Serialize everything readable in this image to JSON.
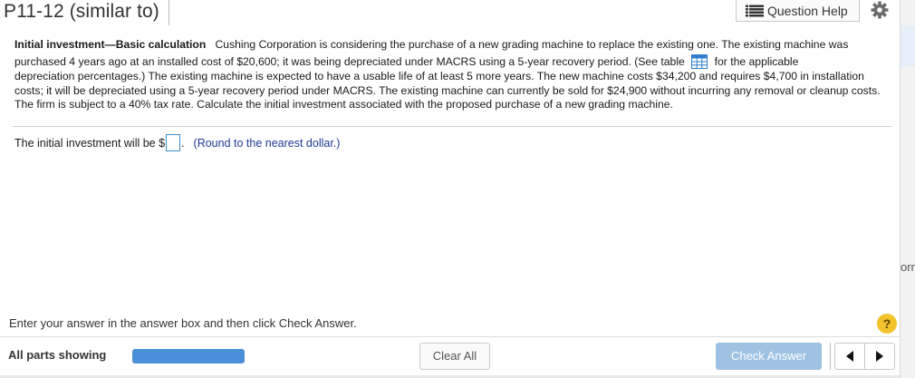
{
  "header": {
    "title": "P11-12 (similar to)",
    "question_help_label": "Question Help",
    "question_help_icon": "list-icon",
    "settings_icon": "gear-icon"
  },
  "problem": {
    "lead": "Initial investment—Basic calculation",
    "p1": "Cushing Corporation is considering the purchase of a new grading machine to replace the existing one. The existing machine was purchased 4 years ago at an installed cost of $20,600; it was being depreciated under MACRS using a 5-year recovery period. (See table",
    "p2": "for the applicable",
    "p3": "depreciation percentages.)",
    "p4": "The existing machine is expected to have a usable life of at least 5 more years. The new machine costs $34,200 and requires $4,700 in installation costs; it will be depreciated using a 5-year recovery period under MACRS. The existing machine can currently be sold for $24,900 without incurring any removal or cleanup costs. The firm is subject to a 40% tax rate. Calculate the initial investment associated with the proposed purchase of a new grading machine.",
    "table_icon": "table-icon"
  },
  "answer": {
    "prefix": "The initial investment will be $",
    "suffix": ".",
    "value": "",
    "hint": "(Round to the nearest dollar.)"
  },
  "footer": {
    "instruction": "Enter your answer in the answer box and then click Check Answer.",
    "help_symbol": "?",
    "parts_label": "All parts showing",
    "progress_fraction": 1.0,
    "clear_label": "Clear All",
    "check_label": "Check Answer",
    "prev_icon": "triangle-left-icon",
    "next_icon": "triangle-right-icon"
  },
  "side_peek": "orr",
  "colors": {
    "accent_blue": "#4a90d9",
    "check_button": "#9fc2e3",
    "hint_text": "#1f3a93",
    "help_circle": "#f3c32b"
  }
}
